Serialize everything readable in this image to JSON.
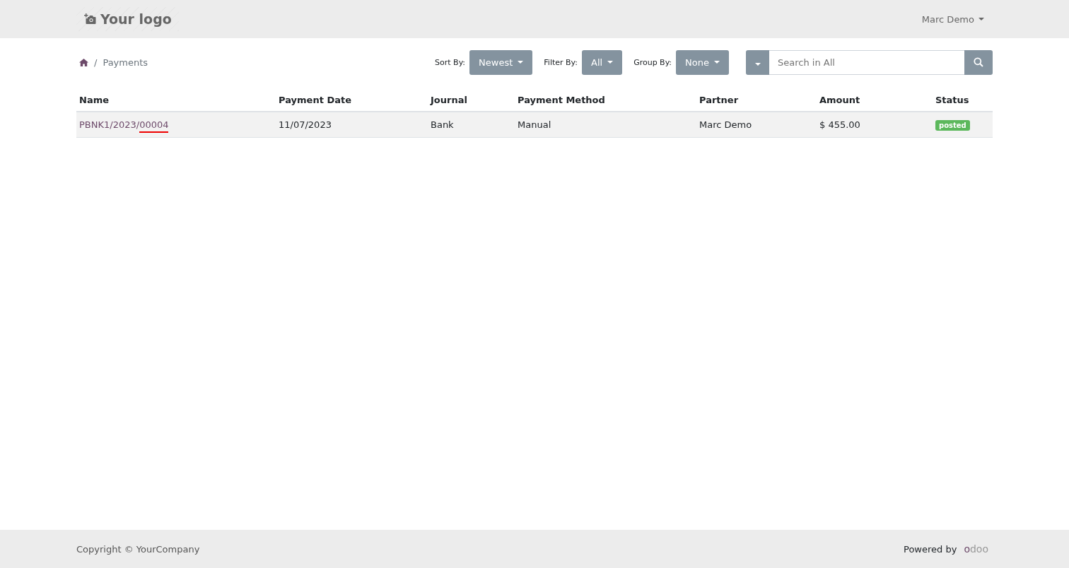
{
  "header": {
    "logo": "Your logo",
    "user": "Marc Demo"
  },
  "breadcrumb": {
    "separator": "/",
    "current": "Payments"
  },
  "toolbar": {
    "sort": {
      "label": "Sort By:",
      "value": "Newest"
    },
    "filter": {
      "label": "Filter By:",
      "value": "All"
    },
    "group": {
      "label": "Group By:",
      "value": "None"
    },
    "search": {
      "placeholder": "Search in All"
    }
  },
  "table": {
    "columns": [
      "Name",
      "Payment Date",
      "Journal",
      "Payment Method",
      "Partner",
      "Amount",
      "Status"
    ],
    "rows": [
      {
        "name": "PBNK1/2023/",
        "name_marked": "00004",
        "date": "11/07/2023",
        "journal": "Bank",
        "method": "Manual",
        "partner": "Marc Demo",
        "amount": "$ 455.00",
        "status": "posted",
        "color": "#5cb85c"
      }
    ]
  },
  "footer": {
    "copyright": "Copyright © YourCompany",
    "powered": "Powered by",
    "brand": "odoo"
  }
}
